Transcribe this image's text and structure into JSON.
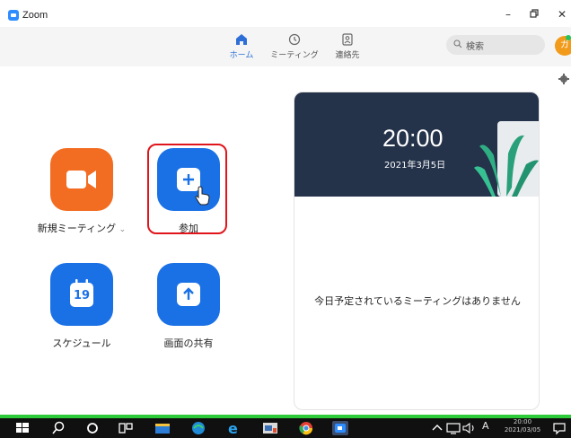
{
  "window": {
    "title": "Zoom",
    "minimize": "–",
    "restore": "▫",
    "close": "✕"
  },
  "nav": {
    "tabs": [
      {
        "label": "ホーム",
        "icon": "home-icon",
        "active": true
      },
      {
        "label": "ミーティング",
        "icon": "clock-icon",
        "active": false
      },
      {
        "label": "連絡先",
        "icon": "contacts-icon",
        "active": false
      }
    ],
    "search_placeholder": "検索",
    "avatar_initial": "ガ"
  },
  "actions": {
    "new_meeting": {
      "label": "新規ミーティング",
      "caret": "⌄",
      "icon": "video-camera-icon"
    },
    "join": {
      "label": "参加",
      "icon": "plus-icon"
    },
    "schedule": {
      "label": "スケジュール",
      "icon": "calendar-icon",
      "day": "19"
    },
    "share_screen": {
      "label": "画面の共有",
      "icon": "upload-arrow-icon"
    }
  },
  "calendar": {
    "time": "20:00",
    "date": "2021年3月5日",
    "empty_message": "今日予定されているミーティングはありません"
  },
  "taskbar": {
    "ime": "A",
    "clock_time": "20:00",
    "clock_date": "2021/03/05"
  },
  "colors": {
    "accent_blue": "#1a71e5",
    "orange": "#f26d21",
    "highlight_red": "#e0151b",
    "header_dark": "#24324a",
    "taskbar_green": "#2dcb3a"
  }
}
